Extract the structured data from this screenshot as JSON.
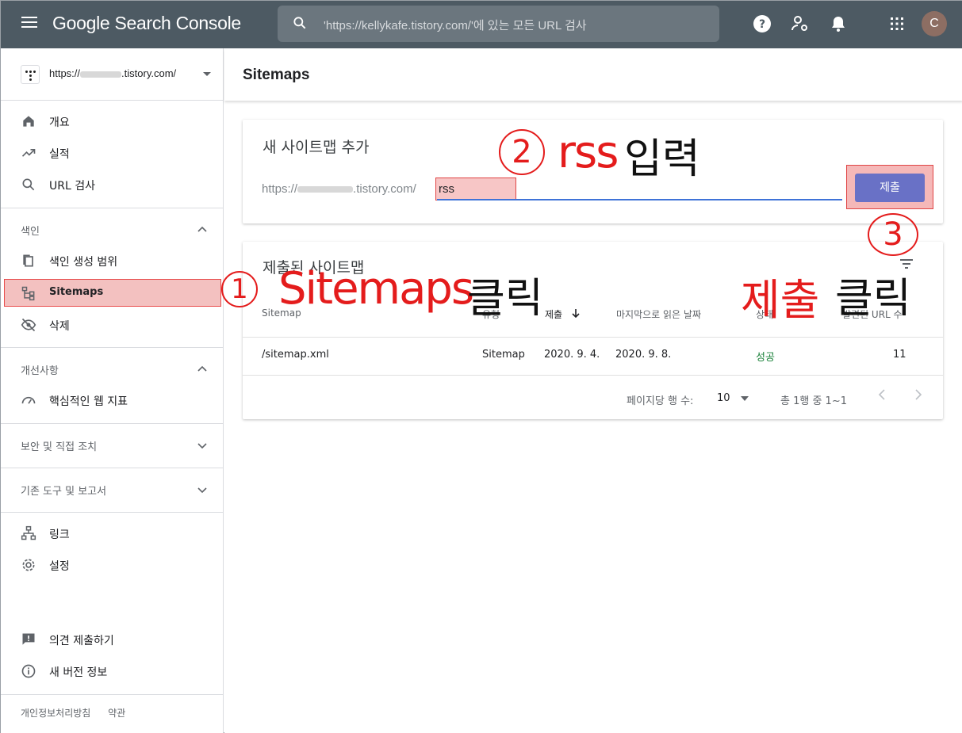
{
  "app": {
    "brand": "Google Search Console",
    "search_placeholder": "'https://kellykafe.tistory.com/'에 있는 모든 URL 검사",
    "avatar_letter": "C"
  },
  "property": {
    "url_prefix": "https://",
    "url_suffix": ".tistory.com/"
  },
  "sidebar": {
    "items_top": [
      {
        "label": "개요",
        "icon": "home-icon"
      },
      {
        "label": "실적",
        "icon": "trending-up-icon"
      },
      {
        "label": "URL 검사",
        "icon": "search-icon"
      }
    ],
    "section_index": "색인",
    "items_index": [
      {
        "label": "색인 생성 범위",
        "icon": "coverage-icon"
      },
      {
        "label": "Sitemaps",
        "icon": "sitemap-icon"
      },
      {
        "label": "삭제",
        "icon": "visibility-off-icon"
      }
    ],
    "section_enhance": "개선사항",
    "items_enhance": [
      {
        "label": "핵심적인 웹 지표",
        "icon": "speed-icon"
      }
    ],
    "section_security": "보안 및 직접 조치",
    "section_legacy": "기존 도구 및 보고서",
    "items_bottom": [
      {
        "label": "링크",
        "icon": "links-icon"
      },
      {
        "label": "설정",
        "icon": "settings-icon"
      }
    ],
    "items_feedback": [
      {
        "label": "의견 제출하기",
        "icon": "feedback-icon"
      },
      {
        "label": "새 버전 정보",
        "icon": "info-icon"
      }
    ],
    "footer": {
      "privacy": "개인정보처리방침",
      "terms": "약관"
    }
  },
  "page": {
    "title": "Sitemaps"
  },
  "add_sitemap": {
    "title": "새 사이트맵 추가",
    "url_prefix": "https://",
    "url_suffix": ".tistory.com/",
    "input_value": "rss",
    "submit_label": "제출"
  },
  "submitted": {
    "title": "제출된 사이트맵",
    "columns": [
      "Sitemap",
      "유형",
      "제출",
      "마지막으로 읽은 날짜",
      "상태",
      "발견된 URL 수"
    ],
    "rows": [
      {
        "sitemap": "/sitemap.xml",
        "type": "Sitemap",
        "submitted": "2020. 9. 4.",
        "last_read": "2020. 9. 8.",
        "status": "성공",
        "urls": "11"
      }
    ],
    "pager": {
      "rows_label": "페이지당 행 수:",
      "rows_value": "10",
      "range": "총 1행 중 1~1"
    }
  },
  "annotations": {
    "step1": {
      "num": "1",
      "text_red": "Sitemaps",
      "text_black": "클릭"
    },
    "step2": {
      "num": "2",
      "text_red": "rss",
      "text_black": "입력"
    },
    "step3": {
      "num": "3",
      "text_red": "제출",
      "text_black": "클릭"
    }
  },
  "colors": {
    "topbar": "#4d5a63",
    "button": "#6971c6",
    "annotation_red": "#e41c1c",
    "status_ok": "#188038"
  }
}
